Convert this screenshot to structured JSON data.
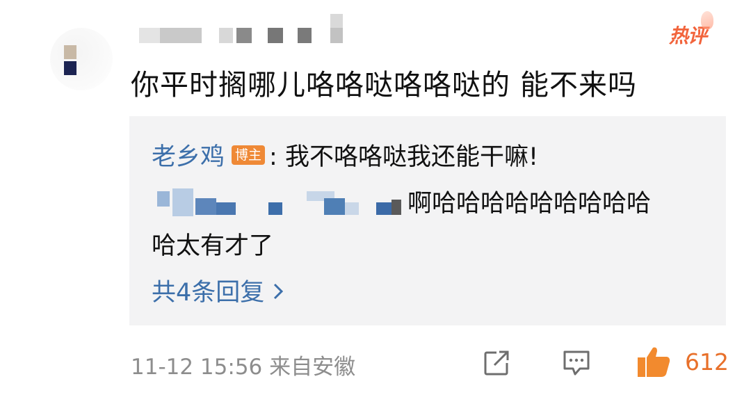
{
  "comment": {
    "text": "你平时搁哪儿咯咯哒咯咯哒的  能不来吗",
    "hot_label": "热评",
    "timestamp": "11-12 15:56  来自安徽",
    "like_count": "612"
  },
  "reply": {
    "author": "老乡鸡",
    "author_badge": "博主",
    "text": ":  我不咯咯哒我还能干嘛!",
    "second_reply_line1": "啊哈哈哈哈哈哈哈哈哈",
    "second_reply_line2": "哈太有才了",
    "more_replies": "共4条回复"
  },
  "colors": {
    "link_blue": "#3c6faa",
    "badge_orange": "#ef8936",
    "like_orange": "#e8702a",
    "hot_red": "#f2643c",
    "reply_bg": "#f3f3f4"
  },
  "icons": [
    "share-icon",
    "comment-icon",
    "thumbs-up-icon",
    "chevron-right-icon"
  ]
}
